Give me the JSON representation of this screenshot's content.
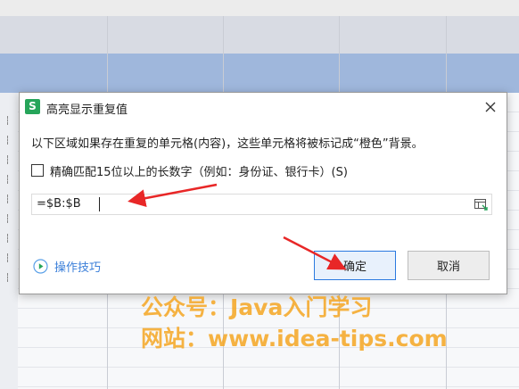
{
  "dialog": {
    "title": "高亮显示重复值",
    "app_icon_letter": "S",
    "description": "以下区域如果存在重复的单元格(内容)，这些单元格将被标记成“橙色”背景。",
    "checkbox_label": "精确匹配15位以上的长数字（例如：身份证、银行卡）(S)",
    "checkbox_checked": false,
    "range_value": "=$B:$B",
    "tips_label": "操作技巧",
    "ok_label": "确定",
    "cancel_label": "取消"
  },
  "watermark": {
    "line1": "公众号：Java入门学习",
    "line2": "网站：www.idea-tips.com"
  },
  "colors": {
    "accent": "#2b7ae0",
    "app_icon": "#26a55a",
    "link": "#3b7fd9",
    "watermark": "#f5a623",
    "arrow": "#e82727"
  }
}
